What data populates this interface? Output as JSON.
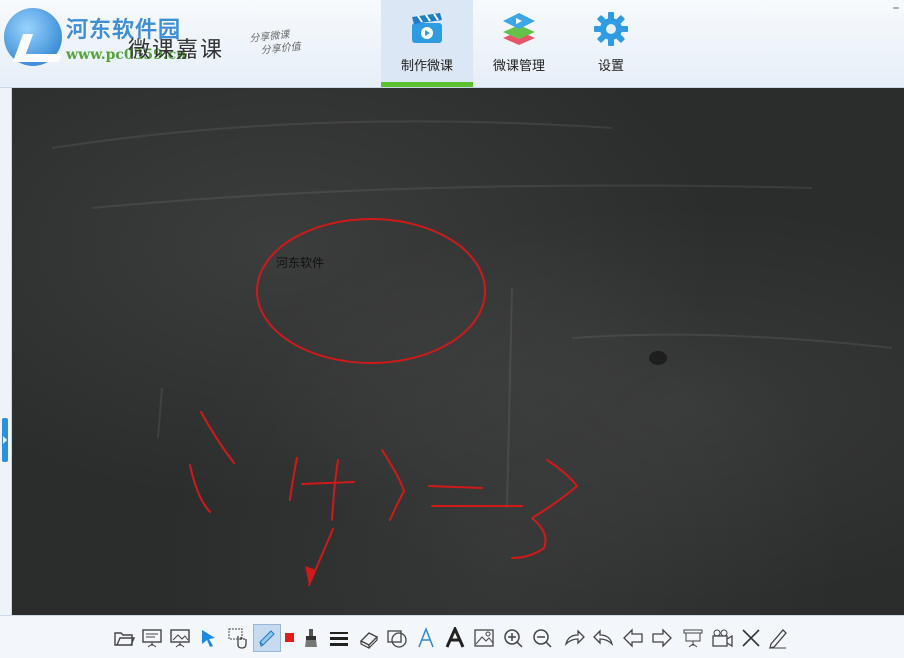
{
  "header": {
    "watermark_title": "河东软件园",
    "watermark_url": "www.pc0359.cn",
    "brand_name": "微课嘉课",
    "slogan_line1": "分享微课",
    "slogan_line2": "分享价值",
    "minimize_label": "–"
  },
  "nav": {
    "tabs": [
      {
        "label": "制作微课",
        "icon": "video-clapper-icon",
        "active": true
      },
      {
        "label": "微课管理",
        "icon": "layers-icon",
        "active": false
      },
      {
        "label": "设置",
        "icon": "gear-icon",
        "active": false
      }
    ]
  },
  "board": {
    "text_label": "河东软件",
    "annotation_color": "#d01a1a",
    "ink_formula": "1+1=3"
  },
  "toolbar": {
    "tools": [
      "open-folder-icon",
      "slideshow-icon",
      "insert-image-icon",
      "pointer-icon",
      "hand-select-icon",
      "pen-icon",
      "color-swatch-icon",
      "brush-icon",
      "line-width-icon",
      "eraser-icon",
      "shape-icon",
      "text-thin-icon",
      "text-bold-icon",
      "picture-icon",
      "zoom-in-icon",
      "zoom-out-icon",
      "redo-icon",
      "undo-icon",
      "previous-icon",
      "next-icon",
      "presentation-icon",
      "camera-icon",
      "close-icon",
      "edit-icon"
    ],
    "selected_tool": "pen-icon",
    "color_swatch": "#e41b1b"
  },
  "colors": {
    "accent_green": "#5cc12f",
    "accent_blue": "#2d8fe0"
  }
}
